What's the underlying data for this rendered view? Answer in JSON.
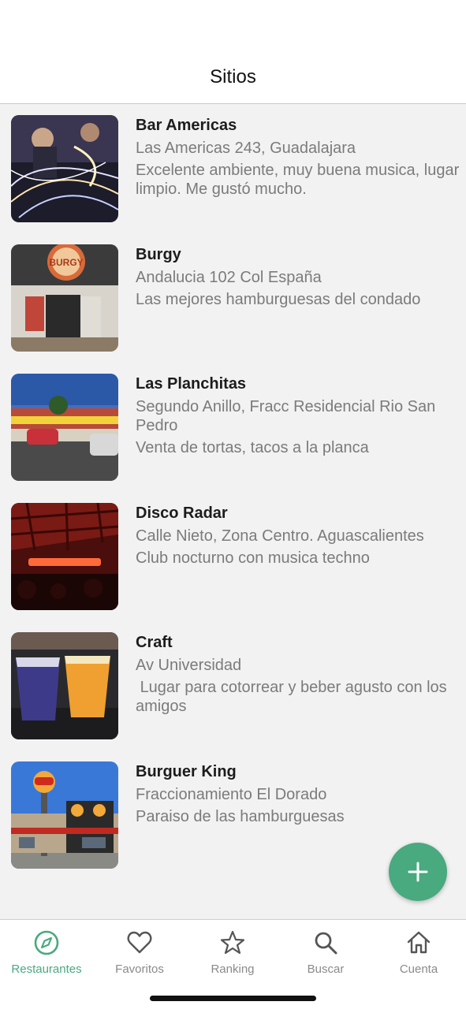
{
  "header": {
    "title": "Sitios"
  },
  "places": [
    {
      "name": "Bar Americas",
      "address": "Las Americas 243, Guadalajara",
      "description": "Excelente ambiente, muy buena musica, lugar limpio. Me gustó mucho."
    },
    {
      "name": "Burgy",
      "address": "Andalucia 102 Col España",
      "description": "Las mejores hamburguesas del condado",
      "sign": "BURGY"
    },
    {
      "name": "Las Planchitas",
      "address": "Segundo Anillo, Fracc Residencial Rio San Pedro",
      "description": "Venta de tortas, tacos a la planca"
    },
    {
      "name": "Disco Radar",
      "address": "Calle Nieto, Zona Centro. Aguascalientes",
      "description": "Club nocturno con musica techno"
    },
    {
      "name": "Craft",
      "address": "Av Universidad",
      "description": " Lugar para cotorrear y beber agusto con los amigos"
    },
    {
      "name": "Burguer King",
      "address": "Fraccionamiento El Dorado",
      "description": "Paraiso de las hamburguesas"
    }
  ],
  "fab": {
    "icon": "plus-icon"
  },
  "tabs": [
    {
      "label": "Restaurantes",
      "icon": "compass-icon",
      "active": true
    },
    {
      "label": "Favoritos",
      "icon": "heart-icon",
      "active": false
    },
    {
      "label": "Ranking",
      "icon": "star-icon",
      "active": false
    },
    {
      "label": "Buscar",
      "icon": "search-icon",
      "active": false
    },
    {
      "label": "Cuenta",
      "icon": "home-icon",
      "active": false
    }
  ],
  "colors": {
    "accent": "#49a97f",
    "inactive": "#8a8a8a",
    "background": "#f2f2f2"
  }
}
